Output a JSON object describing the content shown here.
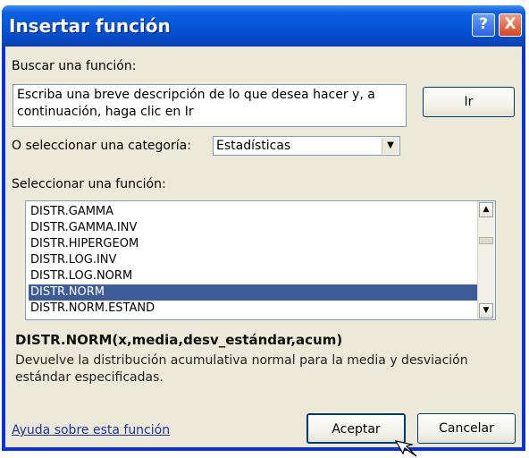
{
  "window": {
    "title": "Insertar función",
    "help_button": "?",
    "close_button": "X"
  },
  "search": {
    "label": "Buscar una función:",
    "value": "Escriba una breve descripción de lo que desea hacer y, a continuación, haga clic en Ir",
    "go_button": "Ir"
  },
  "category": {
    "label": "O seleccionar una categoría:",
    "selected": "Estadísticas"
  },
  "function_list": {
    "label": "Seleccionar una función:",
    "items": [
      "DISTR.GAMMA",
      "DISTR.GAMMA.INV",
      "DISTR.HIPERGEOM",
      "DISTR.LOG.INV",
      "DISTR.LOG.NORM",
      "DISTR.NORM",
      "DISTR.NORM.ESTAND"
    ],
    "selected": "DISTR.NORM"
  },
  "details": {
    "signature": "DISTR.NORM(x,media,desv_estándar,acum)",
    "description": "Devuelve la distribución acumulativa normal para la media y desviación estándar especificadas."
  },
  "footer": {
    "help_link": "Ayuda sobre esta función",
    "ok_button": "Aceptar",
    "cancel_button": "Cancelar"
  },
  "colors": {
    "titlebar": "#0553d6",
    "dialog_bg": "#ece9d8",
    "selection": "#3d5c97",
    "link": "#1c33a8"
  }
}
